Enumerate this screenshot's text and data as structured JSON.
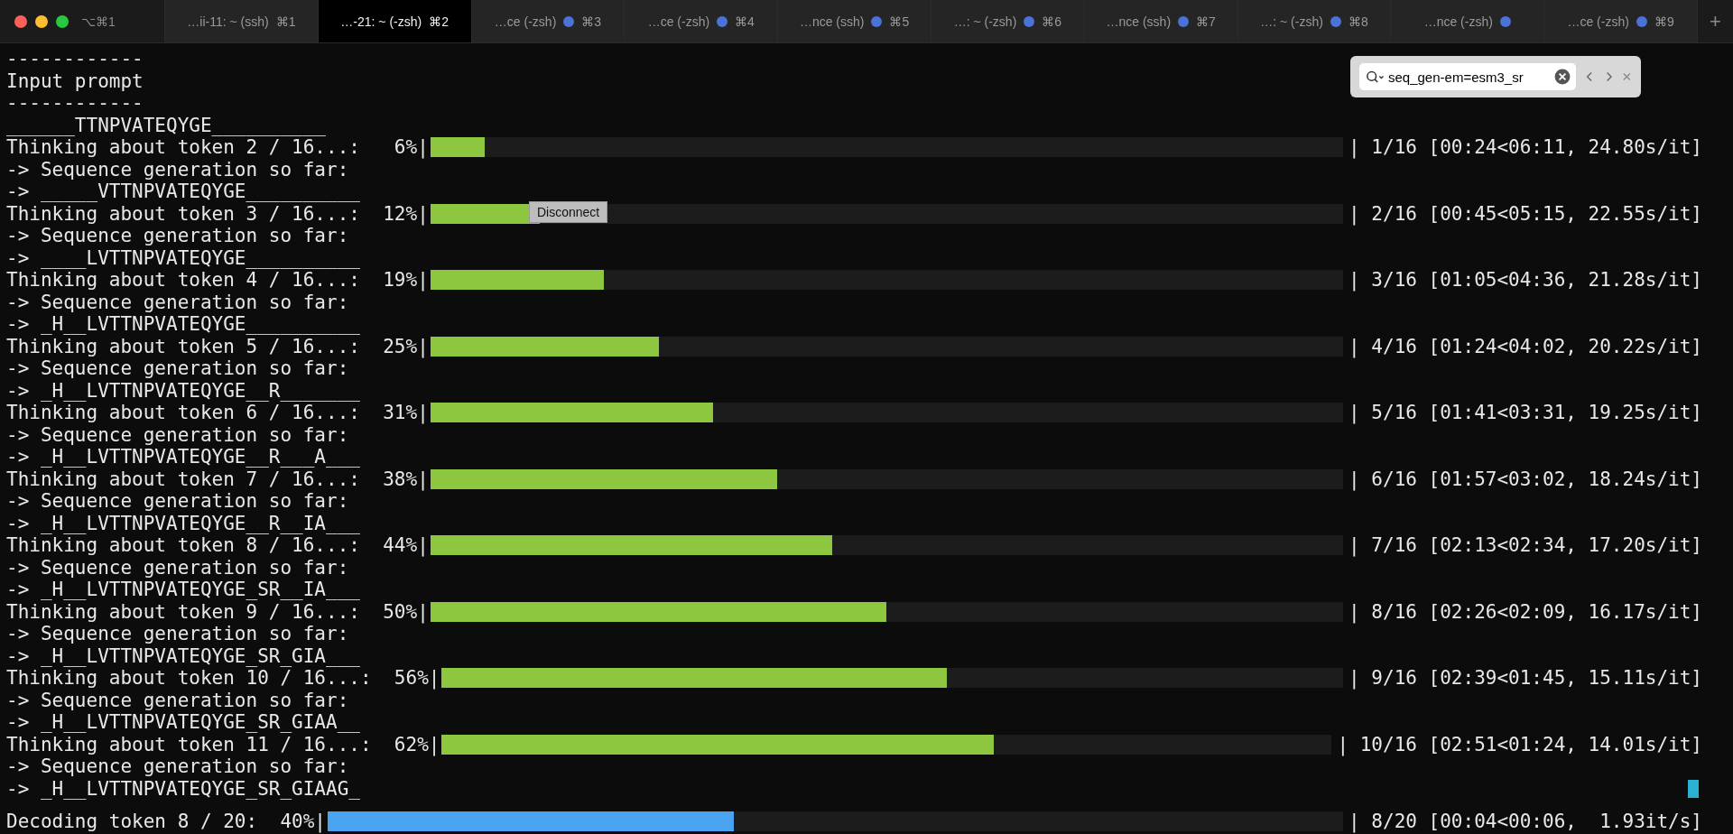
{
  "window_shortcut": "⌥⌘1",
  "tabs": [
    {
      "label": "…ii-11: ~ (ssh)",
      "shortcut": "⌘1",
      "selected": false,
      "activity": false,
      "kind": "tab"
    },
    {
      "label": "…-21: ~ (-zsh)",
      "shortcut": "⌘2",
      "selected": true,
      "activity": false,
      "kind": "tab"
    },
    {
      "label": "…ce (-zsh)",
      "shortcut": "⌘3",
      "selected": false,
      "activity": true,
      "kind": "tab"
    },
    {
      "label": "…ce (-zsh)",
      "shortcut": "⌘4",
      "selected": false,
      "activity": true,
      "kind": "tab"
    },
    {
      "label": "…nce (ssh)",
      "shortcut": "⌘5",
      "selected": false,
      "activity": true,
      "kind": "tab"
    },
    {
      "label": "…: ~ (-zsh)",
      "shortcut": "⌘6",
      "selected": false,
      "activity": true,
      "kind": "tab"
    },
    {
      "label": "…nce (ssh)",
      "shortcut": "⌘7",
      "selected": false,
      "activity": true,
      "kind": "tab"
    },
    {
      "label": "…: ~ (-zsh)",
      "shortcut": "⌘8",
      "selected": false,
      "activity": true,
      "kind": "tab"
    },
    {
      "label": "…nce (-zsh)",
      "selected": false,
      "activity": true,
      "kind": "tab"
    },
    {
      "label": "…ce (-zsh)",
      "shortcut": "⌘9",
      "selected": false,
      "activity": true,
      "kind": "tab"
    }
  ],
  "new_tab": "+",
  "lines": [
    {
      "kind": "text",
      "text": "------------"
    },
    {
      "kind": "text",
      "text": "Input prompt"
    },
    {
      "kind": "text",
      "text": "------------"
    },
    {
      "kind": "text",
      "text": "______TTNPVATEQYGE__________"
    },
    {
      "kind": "progress",
      "text": "Thinking about token 2 / 16...:   6%|",
      "level": 0.06,
      "stats": "| 1/16 [00:24<06:11, 24.80s/it]",
      "color": "#8dc63f"
    },
    {
      "kind": "text",
      "text": "-> Sequence generation so far:"
    },
    {
      "kind": "text",
      "text": "-> _____VTTNPVATEQYGE__________"
    },
    {
      "kind": "progress",
      "text": "Thinking about token 3 / 16...:  12%|",
      "level": 0.12,
      "stats": "| 2/16 [00:45<05:15, 22.55s/it]",
      "color": "#8dc63f"
    },
    {
      "kind": "text",
      "text": "-> Sequence generation so far:"
    },
    {
      "kind": "text",
      "text": "-> ____LVTTNPVATEQYGE__________"
    },
    {
      "kind": "progress",
      "text": "Thinking about token 4 / 16...:  19%|",
      "level": 0.19,
      "stats": "| 3/16 [01:05<04:36, 21.28s/it]",
      "color": "#8dc63f"
    },
    {
      "kind": "text",
      "text": "-> Sequence generation so far:"
    },
    {
      "kind": "text",
      "text": "-> _H__LVTTNPVATEQYGE__________"
    },
    {
      "kind": "progress",
      "text": "Thinking about token 5 / 16...:  25%|",
      "level": 0.25,
      "stats": "| 4/16 [01:24<04:02, 20.22s/it]",
      "color": "#8dc63f"
    },
    {
      "kind": "text",
      "text": "-> Sequence generation so far:"
    },
    {
      "kind": "text",
      "text": "-> _H__LVTTNPVATEQYGE__R_______"
    },
    {
      "kind": "progress",
      "text": "Thinking about token 6 / 16...:  31%|",
      "level": 0.31,
      "stats": "| 5/16 [01:41<03:31, 19.25s/it]",
      "color": "#8dc63f"
    },
    {
      "kind": "text",
      "text": "-> Sequence generation so far:"
    },
    {
      "kind": "text",
      "text": "-> _H__LVTTNPVATEQYGE__R___A___"
    },
    {
      "kind": "progress",
      "text": "Thinking about token 7 / 16...:  38%|",
      "level": 0.38,
      "stats": "| 6/16 [01:57<03:02, 18.24s/it]",
      "color": "#8dc63f"
    },
    {
      "kind": "text",
      "text": "-> Sequence generation so far:"
    },
    {
      "kind": "text",
      "text": "-> _H__LVTTNPVATEQYGE__R__IA___"
    },
    {
      "kind": "progress",
      "text": "Thinking about token 8 / 16...:  44%|",
      "level": 0.44,
      "stats": "| 7/16 [02:13<02:34, 17.20s/it]",
      "color": "#8dc63f"
    },
    {
      "kind": "text",
      "text": "-> Sequence generation so far:"
    },
    {
      "kind": "text",
      "text": "-> _H__LVTTNPVATEQYGE_SR__IA___"
    },
    {
      "kind": "progress",
      "text": "Thinking about token 9 / 16...:  50%|",
      "level": 0.5,
      "stats": "| 8/16 [02:26<02:09, 16.17s/it]",
      "color": "#8dc63f"
    },
    {
      "kind": "text",
      "text": "-> Sequence generation so far:"
    },
    {
      "kind": "text",
      "text": "-> _H__LVTTNPVATEQYGE_SR_GIA___"
    },
    {
      "kind": "progress",
      "text": "Thinking about token 10 / 16...:  56%|",
      "level": 0.56,
      "stats": "| 9/16 [02:39<01:45, 15.11s/it]",
      "color": "#8dc63f"
    },
    {
      "kind": "text",
      "text": "-> Sequence generation so far:"
    },
    {
      "kind": "text",
      "text": "-> _H__LVTTNPVATEQYGE_SR_GIAA__"
    },
    {
      "kind": "progress",
      "text": "Thinking about token 11 / 16...:  62%|",
      "level": 0.62,
      "stats": "| 10/16 [02:51<01:24, 14.01s/it]",
      "color": "#8dc63f"
    },
    {
      "kind": "text",
      "text": "-> Sequence generation so far:"
    },
    {
      "kind": "text",
      "text": "-> _H__LVTTNPVATEQYGE_SR_GIAAG_"
    }
  ],
  "footer": {
    "text": "Decoding token 8 / 20:  40%|",
    "level": 0.4,
    "stats": "| 8/20 [00:04<00:06,  1.93it/s]",
    "color": "#4aa3f0"
  },
  "find_bar": {
    "value": "seq_gen-em=esm3_sr"
  },
  "tooltip": "Disconnect"
}
